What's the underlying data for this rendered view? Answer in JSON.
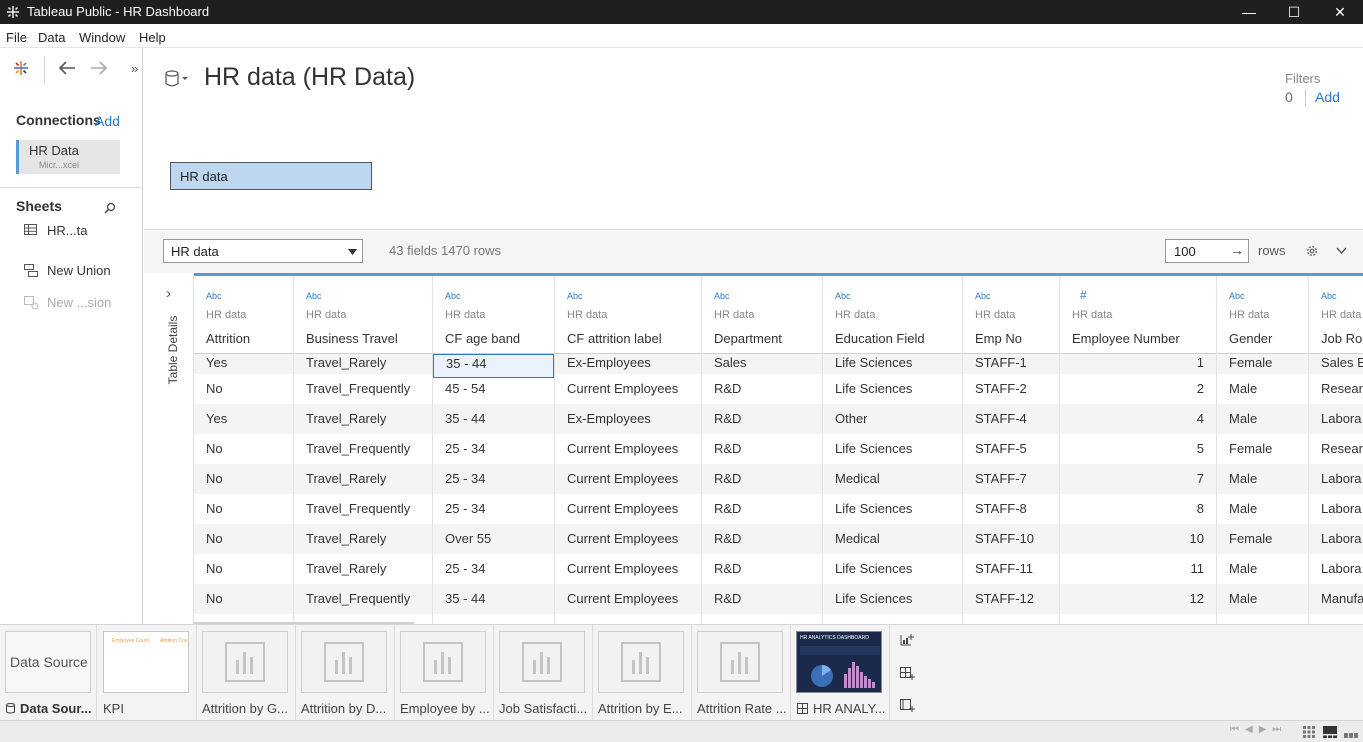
{
  "window": {
    "title": "Tableau Public - HR Dashboard",
    "minimize": "—",
    "maximize": "☐",
    "close": "✕"
  },
  "menu": [
    "File",
    "Data",
    "Window",
    "Help"
  ],
  "nav": {
    "expand": "»"
  },
  "connections": {
    "heading": "Connections",
    "add": "Add",
    "items": [
      {
        "name": "HR Data",
        "type": "Micr...xcel"
      }
    ]
  },
  "sheets": {
    "heading": "Sheets",
    "items": [
      {
        "label": "HR...ta",
        "icon": "table-icon"
      },
      {
        "label": "New Union",
        "icon": "union-icon"
      },
      {
        "label": "New ...sion",
        "icon": "extension-icon"
      }
    ]
  },
  "canvas": {
    "title": "HR data (HR Data)",
    "table_chip": "HR data",
    "filters": {
      "label": "Filters",
      "count": "0",
      "add": "Add"
    }
  },
  "gridbar": {
    "table_select": "HR data",
    "summary": "43 fields 1470 rows",
    "rows_value": "100",
    "rows_label": "rows"
  },
  "table_details": {
    "label": "Table Details",
    "expand": "›"
  },
  "grid": {
    "columns": [
      {
        "type": "Abc",
        "source": "HR data",
        "name": "Attrition"
      },
      {
        "type": "Abc",
        "source": "HR data",
        "name": "Business Travel"
      },
      {
        "type": "Abc",
        "source": "HR data",
        "name": "CF age band"
      },
      {
        "type": "Abc",
        "source": "HR data",
        "name": "CF attrition label"
      },
      {
        "type": "Abc",
        "source": "HR data",
        "name": "Department"
      },
      {
        "type": "Abc",
        "source": "HR data",
        "name": "Education Field"
      },
      {
        "type": "Abc",
        "source": "HR data",
        "name": "Emp No"
      },
      {
        "type": "#",
        "source": "HR data",
        "name": "Employee Number"
      },
      {
        "type": "Abc",
        "source": "HR data",
        "name": "Gender"
      },
      {
        "type": "Abc",
        "source": "HR data",
        "name": "Job Role"
      }
    ],
    "rows": [
      [
        "Yes",
        "Travel_Rarely",
        "35 - 44",
        "Ex-Employees",
        "Sales",
        "Life Sciences",
        "STAFF-1",
        "1",
        "Female",
        "Sales E"
      ],
      [
        "No",
        "Travel_Frequently",
        "45 - 54",
        "Current Employees",
        "R&D",
        "Life Sciences",
        "STAFF-2",
        "2",
        "Male",
        "Resear"
      ],
      [
        "Yes",
        "Travel_Rarely",
        "35 - 44",
        "Ex-Employees",
        "R&D",
        "Other",
        "STAFF-4",
        "4",
        "Male",
        "Labora"
      ],
      [
        "No",
        "Travel_Frequently",
        "25 - 34",
        "Current Employees",
        "R&D",
        "Life Sciences",
        "STAFF-5",
        "5",
        "Female",
        "Resear"
      ],
      [
        "No",
        "Travel_Rarely",
        "25 - 34",
        "Current Employees",
        "R&D",
        "Medical",
        "STAFF-7",
        "7",
        "Male",
        "Labora"
      ],
      [
        "No",
        "Travel_Frequently",
        "25 - 34",
        "Current Employees",
        "R&D",
        "Life Sciences",
        "STAFF-8",
        "8",
        "Male",
        "Labora"
      ],
      [
        "No",
        "Travel_Rarely",
        "Over 55",
        "Current Employees",
        "R&D",
        "Medical",
        "STAFF-10",
        "10",
        "Female",
        "Labora"
      ],
      [
        "No",
        "Travel_Rarely",
        "25 - 34",
        "Current Employees",
        "R&D",
        "Life Sciences",
        "STAFF-11",
        "11",
        "Male",
        "Labora"
      ],
      [
        "No",
        "Travel_Frequently",
        "35 - 44",
        "Current Employees",
        "R&D",
        "Life Sciences",
        "STAFF-12",
        "12",
        "Male",
        "Manufa"
      ]
    ]
  },
  "tabs": {
    "datasource": {
      "thumb_label": "Data Source",
      "label": "Data Sour..."
    },
    "sheets": [
      {
        "label": "KPI",
        "thumb": "kpi",
        "mini1": "Employee Count",
        "mini2": "Attrition Cou"
      },
      {
        "label": "Attrition by G...",
        "thumb": "blank"
      },
      {
        "label": "Attrition by D...",
        "thumb": "blank"
      },
      {
        "label": "Employee by ...",
        "thumb": "blank"
      },
      {
        "label": "Job Satisfacti...",
        "thumb": "blank"
      },
      {
        "label": "Attrition by E...",
        "thumb": "blank"
      },
      {
        "label": "Attrition Rate ...",
        "thumb": "blank"
      },
      {
        "label": "HR ANALY...",
        "thumb": "dashboard",
        "mini_title": "HR ANALYTICS DASHBOARD"
      }
    ]
  },
  "colors": {
    "accent": "#2c7bc6",
    "chip_bg": "#bcd7ef",
    "grid_top": "#5b9bd5",
    "titlebar": "#1f1f1f"
  }
}
